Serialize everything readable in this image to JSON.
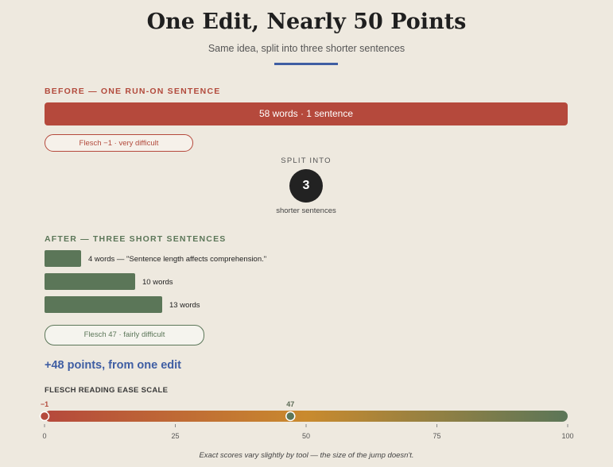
{
  "title": "One Edit, Nearly 50 Points",
  "subtitle": "Same idea, split into three shorter sentences",
  "before": {
    "label": "BEFORE — ONE RUN-ON SENTENCE",
    "bar_text": "58 words · 1 sentence",
    "score_pill": "Flesch −1 · very difficult",
    "color": "#b5493c"
  },
  "split": {
    "label": "SPLIT INTO",
    "count": "3",
    "caption": "shorter sentences"
  },
  "after": {
    "label": "AFTER — THREE SHORT SENTENCES",
    "color": "#5b7658",
    "sentences": [
      {
        "words": 4,
        "label": "4 words — \"Sentence length affects comprehension.\""
      },
      {
        "words": 10,
        "label": "10 words"
      },
      {
        "words": 13,
        "label": "13 words"
      }
    ],
    "score_pill": "Flesch 47 · fairly difficult"
  },
  "points_text": "+48 points, from one edit",
  "scale": {
    "title": "FLESCH READING EASE SCALE",
    "min": 0,
    "max": 100,
    "ticks": [
      "0",
      "25",
      "50",
      "75",
      "100"
    ],
    "before_score": -1,
    "before_label": "−1",
    "after_score": 47,
    "after_label": "47",
    "colors": [
      "#b5493c",
      "#c98a2e",
      "#5b7658"
    ]
  },
  "footnote": "Exact scores vary slightly by tool — the size of the jump doesn't."
}
